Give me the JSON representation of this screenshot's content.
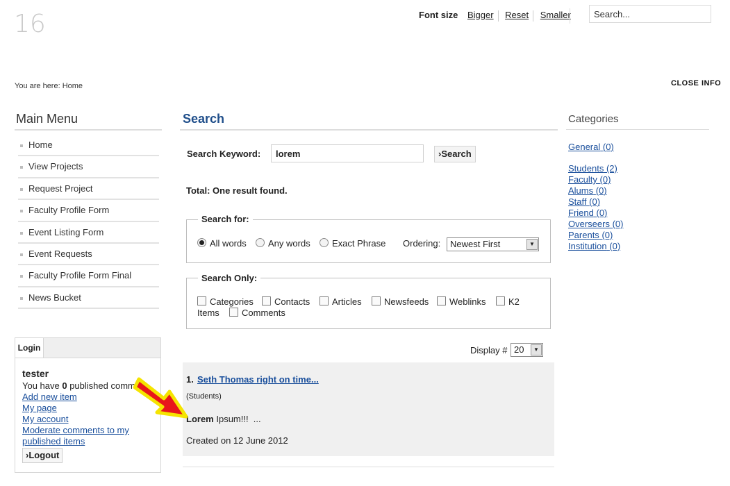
{
  "header": {
    "logo_number": "16",
    "font_size_label": "Font size",
    "bigger": "Bigger",
    "reset": "Reset",
    "smaller": "Smaller",
    "search_placeholder": "Search..."
  },
  "breadcrumb": "You are here: Home",
  "close_info": "CLOSE INFO",
  "main_menu": {
    "title": "Main Menu",
    "items": [
      "Home",
      "View Projects",
      "Request Project",
      "Faculty Profile Form",
      "Event Listing Form",
      "Event Requests",
      "Faculty Profile Form Final",
      "News Bucket"
    ]
  },
  "login": {
    "tab_label": "Login",
    "username": "tester",
    "published_prefix": "You have ",
    "published_count": "0",
    "published_suffix": " published comm",
    "links": [
      "Add new item",
      "My page",
      "My account",
      "Moderate comments to my",
      "published items"
    ],
    "logout_label": "Logout"
  },
  "search": {
    "title": "Search",
    "keyword_label": "Search Keyword:",
    "keyword_value": "lorem",
    "button_label": "Search",
    "total_text": "Total: One result found.",
    "search_for": {
      "legend": "Search for:",
      "options": [
        "All words",
        "Any words",
        "Exact Phrase"
      ],
      "selected": "All words",
      "ordering_label": "Ordering:",
      "ordering_value": "Newest First"
    },
    "search_only": {
      "legend": "Search Only:",
      "options": [
        "Categories",
        "Contacts",
        "Articles",
        "Newsfeeds",
        "Weblinks",
        "K2",
        "Items",
        "Comments"
      ]
    },
    "display_label": "Display #",
    "display_value": "20"
  },
  "result": {
    "number": "1.",
    "title": "Seth Thomas right on time...",
    "category": "(Students)",
    "snippet_bold": "Lorem",
    "snippet_rest": " Ipsum!!!  ...",
    "created": "Created on 12 June 2012"
  },
  "categories": {
    "title": "Categories",
    "items": [
      {
        "name": "General",
        "count": "(0)"
      },
      {
        "name": "Students",
        "count": "(2)"
      },
      {
        "name": "Faculty",
        "count": "(0)"
      },
      {
        "name": "Alums",
        "count": "(0)"
      },
      {
        "name": "Staff",
        "count": "(0)"
      },
      {
        "name": "Friend",
        "count": "(0)"
      },
      {
        "name": "Overseers",
        "count": "(0)"
      },
      {
        "name": "Parents",
        "count": "(0)"
      },
      {
        "name": "Institution",
        "count": "(0)"
      }
    ]
  },
  "colors": {
    "link": "#1a4f9c",
    "title_blue": "#1f4e8a",
    "arrow_fill": "#e8161b",
    "arrow_outline": "#f5e400"
  }
}
